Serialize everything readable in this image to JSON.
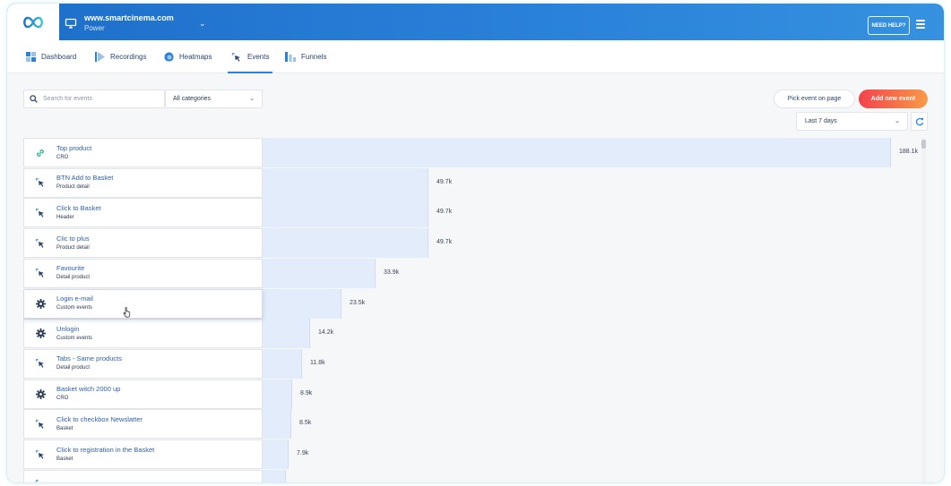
{
  "header": {
    "site_url": "www.smartcinema.com",
    "site_plan": "Power",
    "help_label": "NEED HELP?"
  },
  "nav": {
    "tabs": [
      {
        "label": "Dashboard",
        "icon": "dashboard-icon"
      },
      {
        "label": "Recordings",
        "icon": "play-icon"
      },
      {
        "label": "Heatmaps",
        "icon": "heatmap-icon"
      },
      {
        "label": "Events",
        "icon": "click-icon",
        "active": true
      },
      {
        "label": "Funnels",
        "icon": "funnel-icon"
      }
    ]
  },
  "filters": {
    "search_placeholder": "Search for events",
    "category": "All categories",
    "date_range": "Last 7 days",
    "pick_label": "Pick event on page",
    "add_label": "Add new event"
  },
  "events": {
    "max": 188.1,
    "rows": [
      {
        "name": "Top product",
        "category": "CRO",
        "value": 188.1,
        "label": "188.1k",
        "icon": "link-icon"
      },
      {
        "name": "BTN Add to Basket",
        "category": "Product detail",
        "value": 49.7,
        "label": "49.7k",
        "icon": "click-icon"
      },
      {
        "name": "Click to Basket",
        "category": "Header",
        "value": 49.7,
        "label": "49.7k",
        "icon": "click-icon"
      },
      {
        "name": "Clic to plus",
        "category": "Product detail",
        "value": 49.7,
        "label": "49.7k",
        "icon": "click-icon"
      },
      {
        "name": "Favourite",
        "category": "Detail product",
        "value": 33.9,
        "label": "33.9k",
        "icon": "click-icon"
      },
      {
        "name": "Login e-mail",
        "category": "Custom events",
        "value": 23.5,
        "label": "23.5k",
        "icon": "gear-icon",
        "hover": true
      },
      {
        "name": "Unlogin",
        "category": "Custom events",
        "value": 14.2,
        "label": "14.2k",
        "icon": "gear-icon"
      },
      {
        "name": "Tabs - Same products",
        "category": "Detail product",
        "value": 11.8,
        "label": "11.8k",
        "icon": "click-icon"
      },
      {
        "name": "Basket witch 2000 up",
        "category": "CRO",
        "value": 8.9,
        "label": "8.9k",
        "icon": "gear-icon"
      },
      {
        "name": "Click to checkbox Newslatter",
        "category": "Basket",
        "value": 8.5,
        "label": "8.5k",
        "icon": "click-icon"
      },
      {
        "name": "Click to registration in the Basket",
        "category": "Basket",
        "value": 7.9,
        "label": "7.9k",
        "icon": "click-icon"
      },
      {
        "name": "",
        "category": "",
        "value": 7.0,
        "label": "",
        "icon": "click-icon"
      }
    ]
  },
  "colors": {
    "header": "#2b82d9",
    "accent": "#2b82d9",
    "bar": "#e3ecfa",
    "add_button": "#f3424d"
  }
}
